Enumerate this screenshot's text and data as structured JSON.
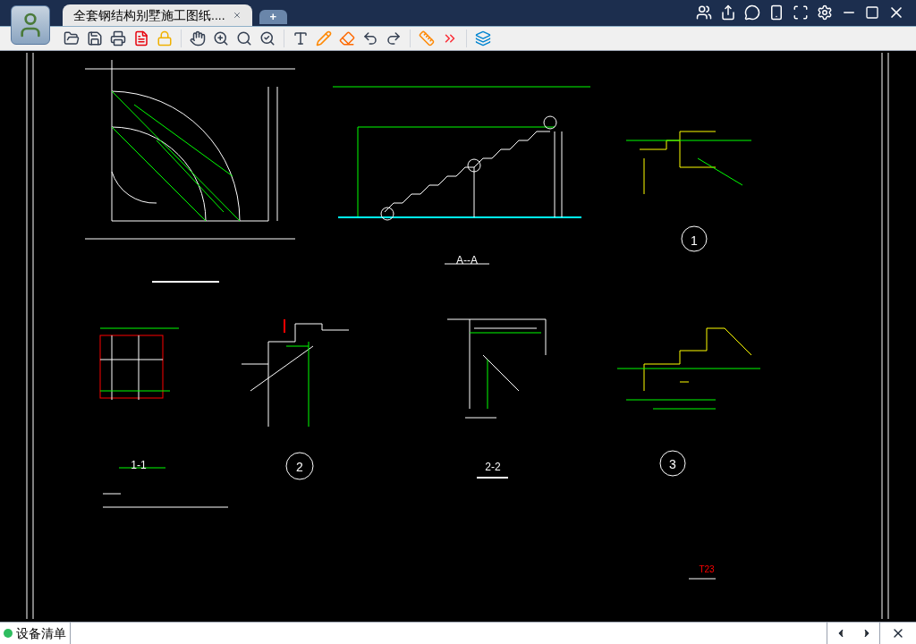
{
  "tabs": [
    {
      "label": "全套钢结构别墅施工图纸....",
      "selected": true
    }
  ],
  "new_tab": "+",
  "drawing_labels": [
    {
      "text": "A--A",
      "color": "#ffffff"
    },
    {
      "text": "1",
      "color": "#ffffff"
    },
    {
      "text": "1-1",
      "color": "#ffffff"
    },
    {
      "text": "2",
      "color": "#ffffff"
    },
    {
      "text": "2-2",
      "color": "#ffffff"
    },
    {
      "text": "3",
      "color": "#ffffff"
    },
    {
      "text": "T23",
      "color": "#ff0000"
    }
  ],
  "status_bar": {
    "item": "设备清单"
  }
}
